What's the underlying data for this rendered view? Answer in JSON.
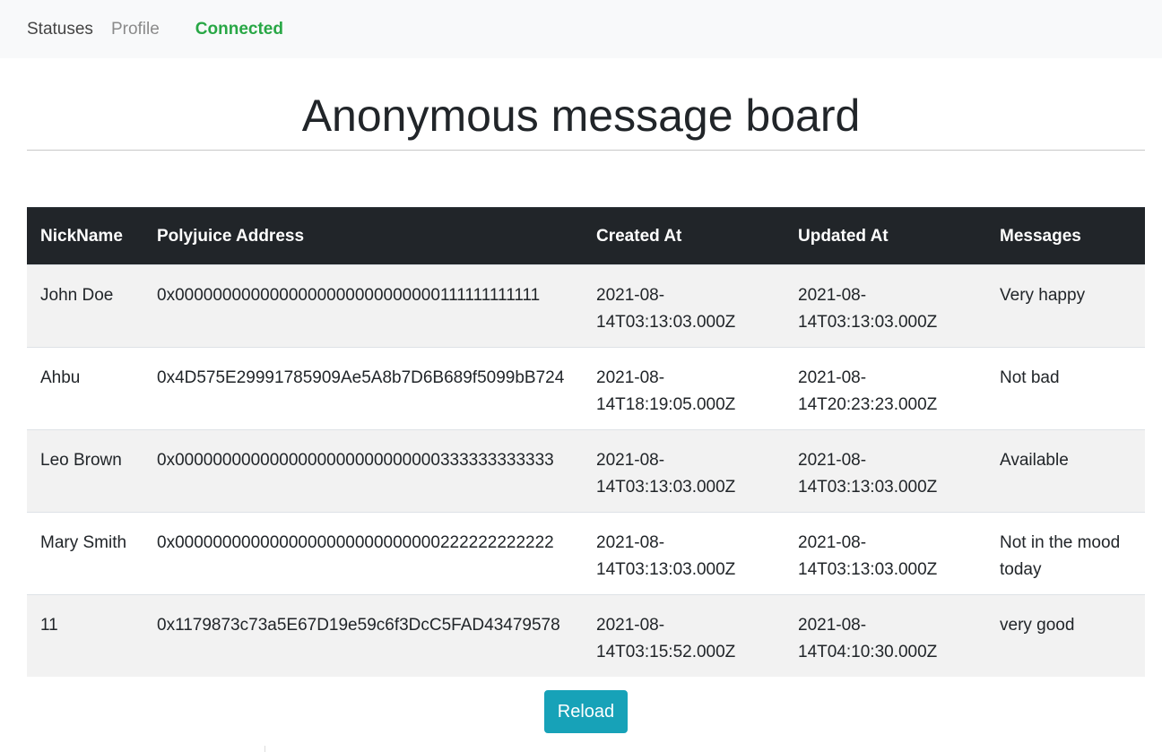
{
  "nav": {
    "statuses": "Statuses",
    "profile": "Profile",
    "status": "Connected"
  },
  "page": {
    "title": "Anonymous message board"
  },
  "table": {
    "headers": [
      "NickName",
      "Polyjuice Address",
      "Created At",
      "Updated At",
      "Messages"
    ],
    "rows": [
      [
        "John Doe",
        "0x0000000000000000000000000000111111111111",
        "2021-08-14T03:13:03.000Z",
        "2021-08-14T03:13:03.000Z",
        "Very happy"
      ],
      [
        "Ahbu",
        "0x4D575E29991785909Ae5A8b7D6B689f5099bB724",
        "2021-08-14T18:19:05.000Z",
        "2021-08-14T20:23:23.000Z",
        "Not bad"
      ],
      [
        "Leo Brown",
        "0x0000000000000000000000000000333333333333",
        "2021-08-14T03:13:03.000Z",
        "2021-08-14T03:13:03.000Z",
        "Available"
      ],
      [
        "Mary Smith",
        "0x0000000000000000000000000000222222222222",
        "2021-08-14T03:13:03.000Z",
        "2021-08-14T03:13:03.000Z",
        "Not in the mood today"
      ],
      [
        "11",
        "0x1179873c73a5E67D19e59c6f3DcC5FAD43479578",
        "2021-08-14T03:15:52.000Z",
        "2021-08-14T04:10:30.000Z",
        "very good"
      ]
    ]
  },
  "actions": {
    "reload": "Reload"
  },
  "colors": {
    "connected": "#28a745",
    "header_bg": "#212529",
    "reload_bg": "#17a2b8"
  }
}
